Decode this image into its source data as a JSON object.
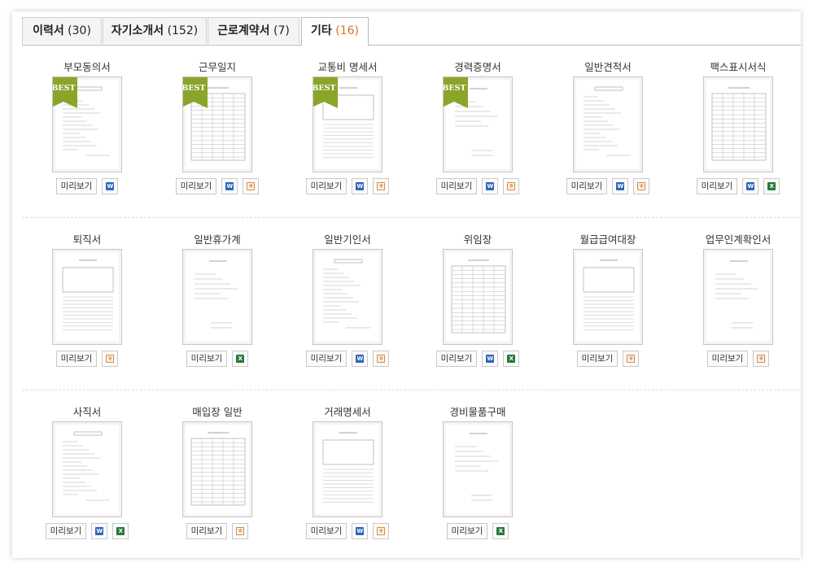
{
  "tabs": [
    {
      "label": "이력서",
      "count": "(30)",
      "active": false
    },
    {
      "label": "자기소개서",
      "count": "(152)",
      "active": false
    },
    {
      "label": "근로계약서",
      "count": "(7)",
      "active": false
    },
    {
      "label": "기타",
      "count": "(16)",
      "active": true
    }
  ],
  "preview_label": "미리보기",
  "best_label": "BEST",
  "colors": {
    "accent": "#e1701e",
    "ribbon": "#8aa52a",
    "word": "#2c66b8",
    "excel": "#25793b",
    "hwp": "#e08a2e"
  },
  "items": [
    {
      "title": "부모동의서",
      "best": true,
      "files": [
        "word-icon"
      ]
    },
    {
      "title": "근무일지",
      "best": true,
      "files": [
        "word-icon",
        "hwp-icon"
      ]
    },
    {
      "title": "교통비 명세서",
      "best": true,
      "files": [
        "word-icon",
        "hwp-icon"
      ]
    },
    {
      "title": "경력증명서",
      "best": true,
      "files": [
        "word-icon",
        "hwp-icon"
      ]
    },
    {
      "title": "일반견적서",
      "best": false,
      "files": [
        "word-icon",
        "hwp-icon"
      ]
    },
    {
      "title": "팩스표시서식",
      "best": false,
      "files": [
        "word-icon",
        "excel-icon"
      ]
    },
    {
      "title": "퇴직서",
      "best": false,
      "files": [
        "hwp-icon"
      ]
    },
    {
      "title": "일반휴가계",
      "best": false,
      "files": [
        "excel-icon"
      ]
    },
    {
      "title": "일반기인서",
      "best": false,
      "files": [
        "word-icon",
        "hwp-icon"
      ]
    },
    {
      "title": "위임장",
      "best": false,
      "files": [
        "word-icon",
        "excel-icon"
      ]
    },
    {
      "title": "월급급여대장",
      "best": false,
      "files": [
        "hwp-icon"
      ]
    },
    {
      "title": "업무인계확인서",
      "best": false,
      "files": [
        "hwp-icon"
      ]
    },
    {
      "title": "사직서",
      "best": false,
      "files": [
        "word-icon",
        "excel-icon"
      ]
    },
    {
      "title": "매입장 일반",
      "best": false,
      "files": [
        "hwp-icon"
      ]
    },
    {
      "title": "거래명세서",
      "best": false,
      "files": [
        "word-icon",
        "hwp-icon"
      ]
    },
    {
      "title": "경비물품구매",
      "best": false,
      "files": [
        "excel-icon"
      ]
    }
  ]
}
